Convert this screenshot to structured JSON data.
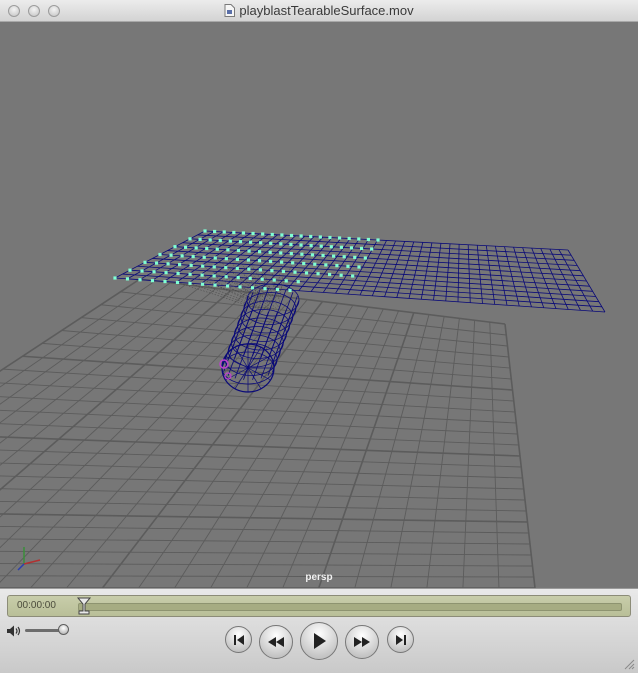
{
  "window": {
    "title": "playblastTearableSurface.mov",
    "file_icon": "movie-file-icon"
  },
  "viewport": {
    "camera_label": "persp",
    "background_color": "#777777",
    "wireframe_color": "#0a0a78",
    "constraint_point_color": "#7fffd4",
    "grid_color": "#5c5c5c"
  },
  "player": {
    "timecode": "00:00:00",
    "progress": 0,
    "volume": 0.85,
    "icons": [
      "volume-icon",
      "go-to-start-icon",
      "rewind-icon",
      "play-icon",
      "fast-forward-icon",
      "go-to-end-icon",
      "resize-grip-icon"
    ]
  }
}
